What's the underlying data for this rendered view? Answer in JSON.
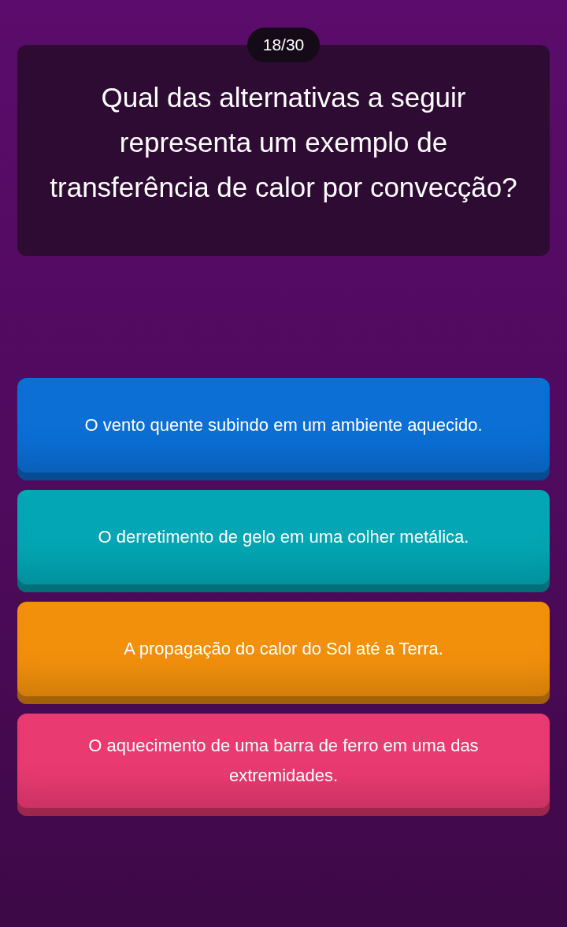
{
  "progress": "18/30",
  "question": "Qual das alternativas a seguir representa um exemplo de transferência de calor por convecção?",
  "options": [
    {
      "text": "O vento quente subindo em um ambiente aquecido.",
      "color": "#0b6fd6"
    },
    {
      "text": "O derretimento de gelo em uma colher metálica.",
      "color": "#03a6b4"
    },
    {
      "text": "A propagação do calor do Sol até a Terra.",
      "color": "#f2900c"
    },
    {
      "text": "O aquecimento de uma barra de ferro em uma das extremidades.",
      "color": "#e93a72"
    }
  ]
}
